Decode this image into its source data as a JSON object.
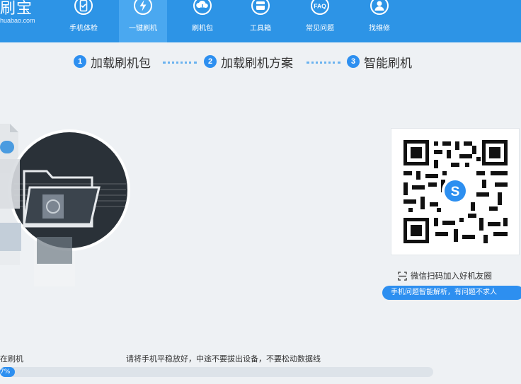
{
  "header": {
    "brand_title": "刷宝",
    "brand_sub": "huabao.com",
    "nav": [
      {
        "label": "手机体检",
        "icon": "phone-check-icon"
      },
      {
        "label": "一键刷机",
        "icon": "lightning-icon",
        "active": true
      },
      {
        "label": "刷机包",
        "icon": "cloud-package-icon"
      },
      {
        "label": "工具箱",
        "icon": "toolbox-icon"
      },
      {
        "label": "常见问题",
        "icon": "faq-icon"
      },
      {
        "label": "找维修",
        "icon": "repair-person-icon"
      }
    ],
    "accent_color": "#2d94e6"
  },
  "steps": [
    {
      "num": "1",
      "label": "加载刷机包"
    },
    {
      "num": "2",
      "label": "加载刷机方案"
    },
    {
      "num": "3",
      "label": "智能刷机"
    }
  ],
  "qr": {
    "caption": "微信扫码加入好机友圈",
    "pill_text": "手机问题智能解析，有问题不求人"
  },
  "status": {
    "left_text": "在刷机",
    "hint": "请将手机平稳放好，中途不要拔出设备，不要松动数据线",
    "progress_label": "7%",
    "progress_value": 0.07
  }
}
